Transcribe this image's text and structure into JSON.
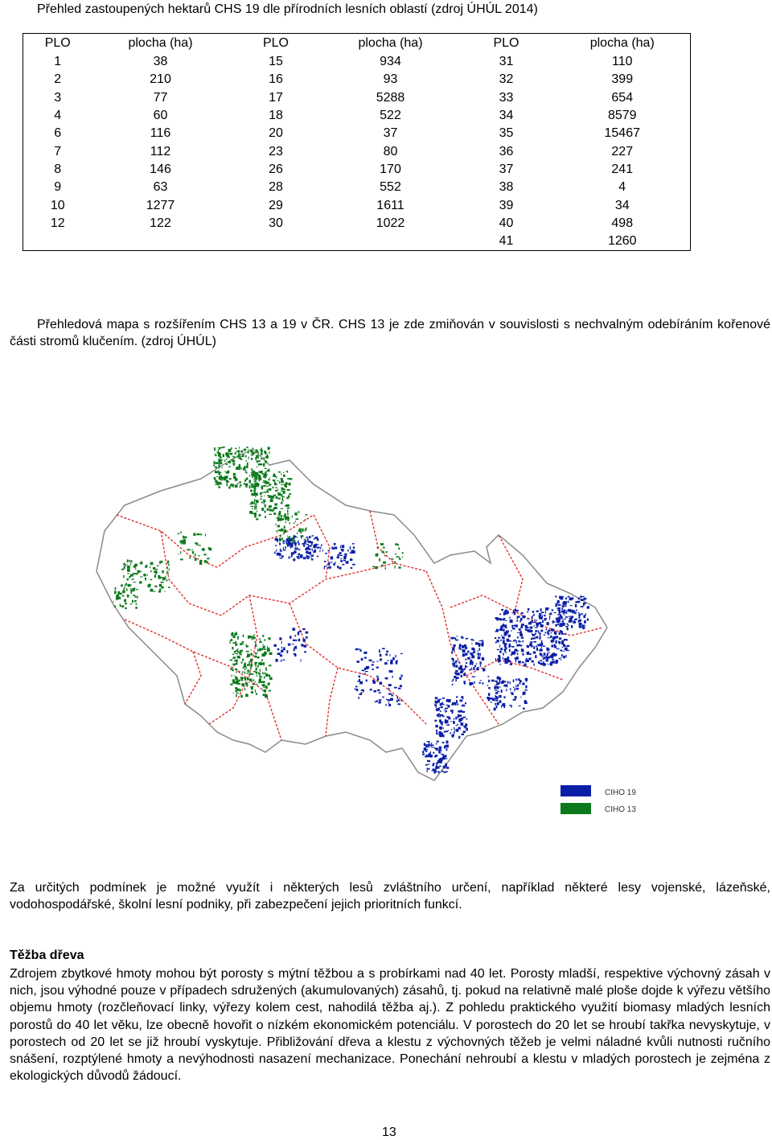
{
  "table_title": "Přehled zastoupených hektarů CHS 19 dle přírodních lesních oblastí (zdroj ÚHÚL 2014)",
  "table": {
    "headers": [
      "PLO",
      "plocha (ha)",
      "PLO",
      "plocha (ha)",
      "PLO",
      "plocha (ha)"
    ],
    "rows": [
      [
        "1",
        "38",
        "15",
        "934",
        "31",
        "110"
      ],
      [
        "2",
        "210",
        "16",
        "93",
        "32",
        "399"
      ],
      [
        "3",
        "77",
        "17",
        "5288",
        "33",
        "654"
      ],
      [
        "4",
        "60",
        "18",
        "522",
        "34",
        "8579"
      ],
      [
        "6",
        "116",
        "20",
        "37",
        "35",
        "15467"
      ],
      [
        "7",
        "112",
        "23",
        "80",
        "36",
        "227"
      ],
      [
        "8",
        "146",
        "26",
        "170",
        "37",
        "241"
      ],
      [
        "9",
        "63",
        "28",
        "552",
        "38",
        "4"
      ],
      [
        "10",
        "1277",
        "29",
        "1611",
        "39",
        "34"
      ],
      [
        "12",
        "122",
        "30",
        "1022",
        "40",
        "498"
      ],
      [
        "",
        "",
        "",
        "",
        "41",
        "1260"
      ]
    ]
  },
  "map_caption": "Přehledová mapa s rozšířením CHS 13 a 19 v ČR. CHS 13 je zde zmiňován v souvislosti s nechvalným odebíráním kořenové části stromů klučením. (zdroj ÚHÚL)",
  "map_legend": [
    {
      "label": "CIHO 19",
      "color": "#0a1fa8"
    },
    {
      "label": "CIHO 13",
      "color": "#0c7a1c"
    }
  ],
  "map_colors": {
    "border": "#e03030",
    "land": "#ffffff",
    "outline": "#8a8a8a"
  },
  "para_special": "Za určitých podmínek je možné využít i některých lesů zvláštního určení, například některé lesy vojenské, lázeňské, vodohospodářské, školní lesní podniky, při zabezpečení jejich prioritních funkcí.",
  "section_heading": "Těžba dřeva",
  "para_tezba": "Zdrojem zbytkové hmoty mohou být porosty s mýtní těžbou a s probírkami nad 40 let. Porosty mladší, respektive výchovný zásah v nich, jsou výhodné pouze v případech sdružených (akumulovaných) zásahů, tj. pokud na relativně malé ploše dojde k výřezu většího objemu hmoty (rozčleňovací linky, výřezy kolem cest, nahodilá těžba aj.). Z pohledu praktického využití biomasy mladých lesních porostů do 40 let věku, lze obecně hovořit o nízkém ekonomickém potenciálu. V porostech do 20 let se hroubí takřka nevyskytuje, v porostech od 20 let se již hroubí vyskytuje. Přibližování dřeva a klestu z výchovných těžeb je velmi náladné kvůli nutnosti ručního snášení, rozptýlené hmoty a nevýhodnosti nasazení mechanizace. Ponechání nehroubí a klestu v mladých porostech je zejména z ekologických důvodů žádoucí.",
  "page_number": "13"
}
